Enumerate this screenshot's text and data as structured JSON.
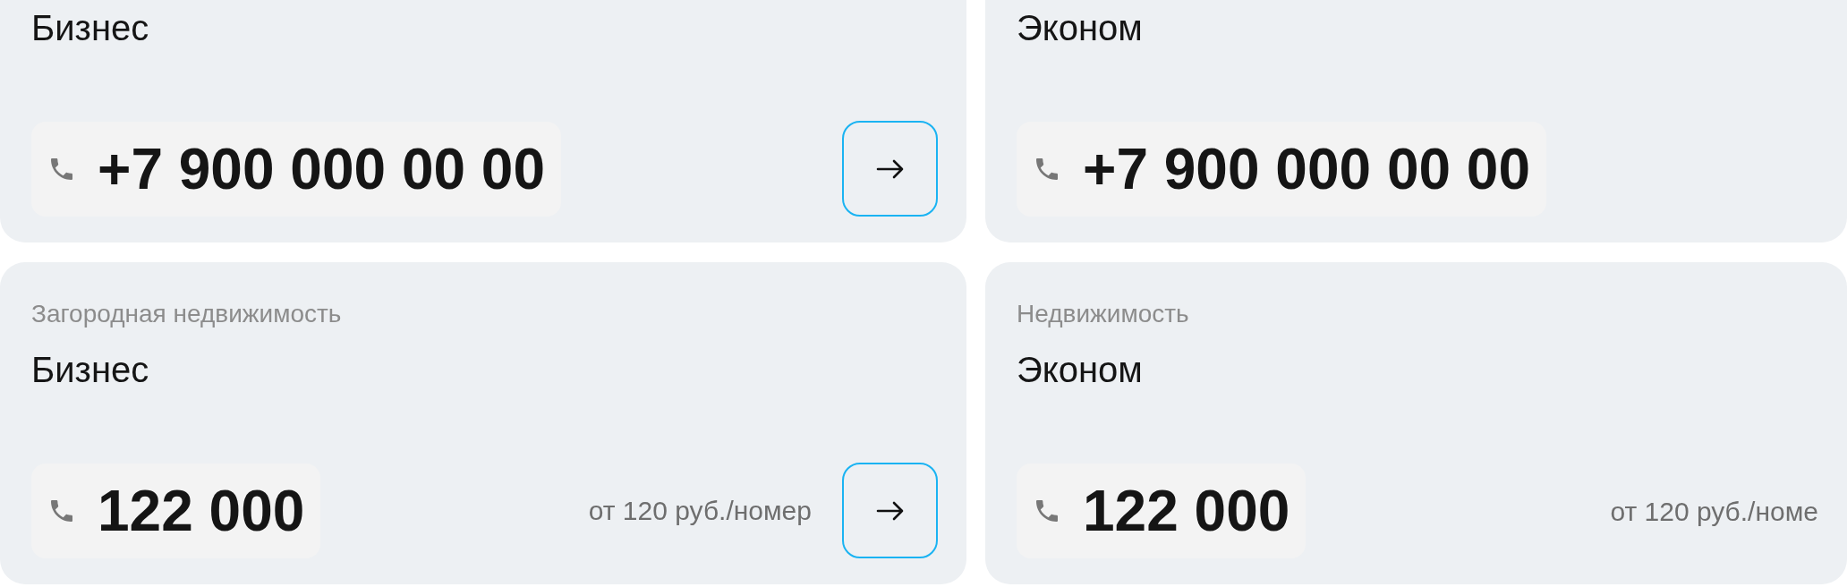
{
  "cards": [
    {
      "title": "Бизнес",
      "phone": "+7 900 000 00 00",
      "arrow_button": true
    },
    {
      "title": "Эконом",
      "phone": "+7 900 000 00 00",
      "arrow_button": false
    },
    {
      "subtitle": "Загородная недвижимость",
      "title": "Бизнес",
      "phone": "122 000",
      "price": "от 120 руб./номер",
      "arrow_button": true
    },
    {
      "subtitle": "Недвижимость",
      "title": "Эконом",
      "phone": "122 000",
      "price": "от 120 руб./номе",
      "arrow_button": false
    }
  ]
}
